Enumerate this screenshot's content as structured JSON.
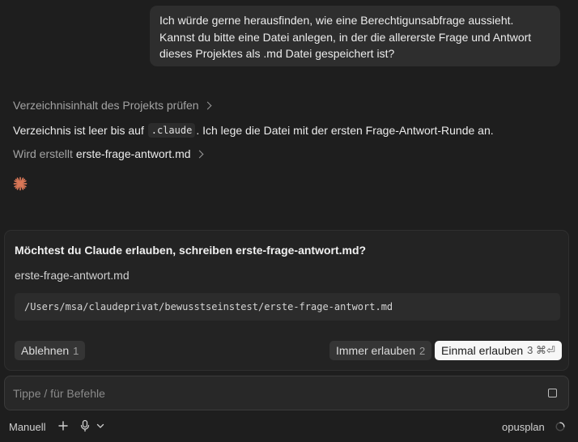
{
  "conversation": {
    "user_message": "Ich würde gerne herausfinden, wie eine Berechtigunsabfrage aussieht. Kannst du bitte eine Datei anlegen, in der die allererste Frage und Antwort dieses Projektes als .md Datei gespeichert ist?",
    "step_check_dir": "Verzeichnisinhalt des Projekts prüfen",
    "assistant_text_before": "Verzeichnis ist leer bis auf ",
    "assistant_code": ".claude",
    "assistant_text_after": ". Ich lege die Datei mit der ersten Frage-Antwort-Runde an.",
    "step_creating_prefix": "Wird erstellt",
    "step_creating_file": "erste-frage-antwort.md"
  },
  "permission": {
    "title": "Möchtest du Claude erlauben, schreiben erste-frage-antwort.md?",
    "file_name": "erste-frage-antwort.md",
    "file_path": "/Users/msa/claudeprivat/bewusstseinstest/erste-frage-antwort.md",
    "deny_label": "Ablehnen",
    "deny_key": "1",
    "always_label": "Immer erlauben",
    "always_key": "2",
    "once_label": "Einmal erlauben",
    "once_key": "3 ⌘⏎"
  },
  "composer": {
    "placeholder": "Tippe / für Befehle"
  },
  "footer": {
    "mode_label": "Manuell",
    "model_label": "opusplan"
  },
  "colors": {
    "accent": "#d97757",
    "background": "#1e1e1e"
  }
}
